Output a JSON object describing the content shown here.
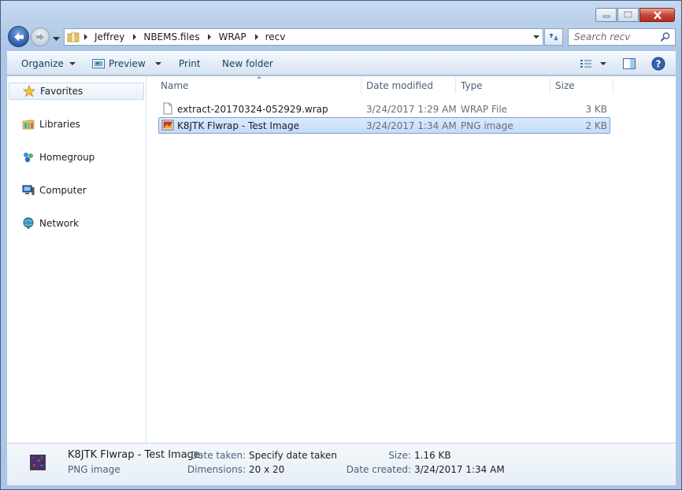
{
  "window": {
    "caption_buttons": [
      "minimize",
      "maximize",
      "close"
    ]
  },
  "nav": {
    "back_icon": "back-arrow-icon",
    "forward_icon": "forward-arrow-icon"
  },
  "address": {
    "breadcrumbs": [
      "Jeffrey",
      "NBEMS.files",
      "WRAP",
      "recv"
    ]
  },
  "search": {
    "placeholder": "Search recv"
  },
  "toolbar": {
    "organize": "Organize",
    "preview": "Preview",
    "print": "Print",
    "new_folder": "New folder"
  },
  "sidebar": {
    "favorites": "Favorites",
    "libraries": "Libraries",
    "homegroup": "Homegroup",
    "computer": "Computer",
    "network": "Network"
  },
  "columns": {
    "name": "Name",
    "date_modified": "Date modified",
    "type": "Type",
    "size": "Size"
  },
  "files": [
    {
      "name": "extract-20170324-052929.wrap",
      "date": "3/24/2017 1:29 AM",
      "type": "WRAP File",
      "size": "3 KB",
      "icon": "document-icon",
      "selected": false
    },
    {
      "name": "K8JTK Flwrap - Test Image",
      "date": "3/24/2017 1:34 AM",
      "type": "PNG image",
      "size": "2 KB",
      "icon": "image-file-icon",
      "selected": true
    }
  ],
  "details": {
    "title": "K8JTK Flwrap - Test Image",
    "subtitle": "PNG image",
    "date_taken_label": "Date taken:",
    "date_taken_value": "Specify date taken",
    "dimensions_label": "Dimensions:",
    "dimensions_value": "20 x 20",
    "size_label": "Size:",
    "size_value": "1.16 KB",
    "date_created_label": "Date created:",
    "date_created_value": "3/24/2017 1:34 AM"
  },
  "colors": {
    "accent": "#1e395b",
    "selection": "#c1dcfc",
    "selection_border": "#7da2ce"
  }
}
